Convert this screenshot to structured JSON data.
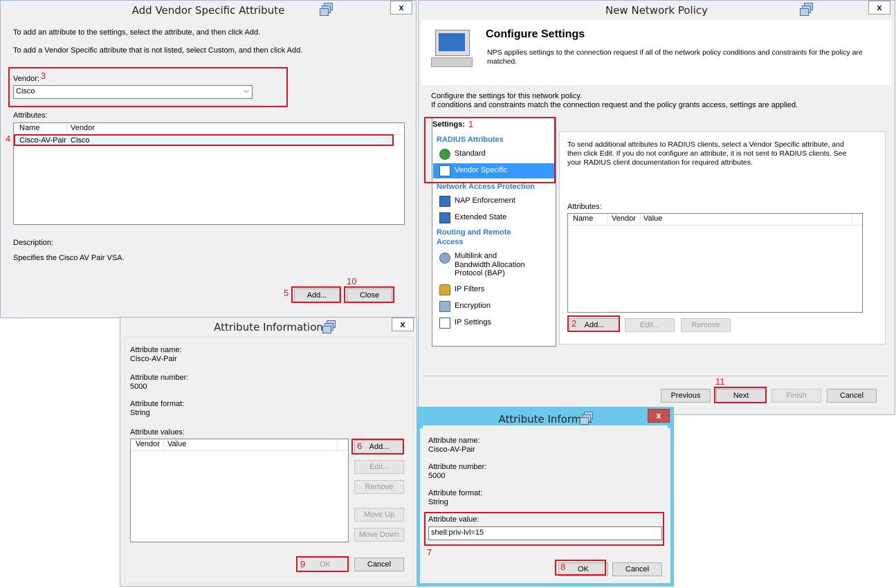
{
  "vsa_dialog": {
    "title": "Add Vendor Specific Attribute",
    "close_glyph": "x",
    "instruction1": "To add an attribute to the settings, select the attribute, and then click Add.",
    "instruction2": "To add a Vendor Specific attribute that is not listed, select Custom, and then click Add.",
    "vendor_label": "Vendor:",
    "vendor_value": "Cisco",
    "attributes_label": "Attributes:",
    "columns": [
      "Name",
      "Vendor"
    ],
    "rows": [
      {
        "name": "Cisco-AV-Pair",
        "vendor": "Cisco"
      }
    ],
    "description_label": "Description:",
    "description_text": "Specifies the Cisco AV Pair VSA.",
    "add_label": "Add...",
    "close_label": "Close"
  },
  "policy_window": {
    "title": "New Network Policy",
    "close_glyph": "x",
    "header_title": "Configure Settings",
    "header_text": "NPS applies settings to the connection request if all of the network policy conditions and constraints for the policy are matched.",
    "intro1": "Configure the settings for this network policy.",
    "intro2": "If conditions and constraints match the connection request and the policy grants access, settings are applied.",
    "settings_label": "Settings:",
    "nav": {
      "radius_header": "RADIUS Attributes",
      "standard": "Standard",
      "vendor_specific": "Vendor Specific",
      "nap_header": "Network Access Protection",
      "nap_enforcement": "NAP Enforcement",
      "extended_state": "Extended State",
      "routing_header_1": "Routing and Remote",
      "routing_header_2": "Access",
      "multilink_1": "Multilink and",
      "multilink_2": "Bandwidth Allocation",
      "multilink_3": "Protocol (BAP)",
      "ip_filters": "IP Filters",
      "encryption": "Encryption",
      "ip_settings": "IP Settings"
    },
    "panel_text": "To send additional attributes to RADIUS clients, select a Vendor Specific attribute, and then click Edit. If you do not configure an attribute, it is not sent to RADIUS clients. See your RADIUS client documentation for required attributes.",
    "attributes_label": "Attributes:",
    "columns": [
      "Name",
      "Vendor",
      "Value"
    ],
    "add_label": "Add...",
    "edit_label": "Edit...",
    "remove_label": "Remove",
    "previous_label": "Previous",
    "next_label": "Next",
    "finish_label": "Finish",
    "cancel_label": "Cancel"
  },
  "attr_info_1": {
    "title": "Attribute Information",
    "close_glyph": "x",
    "name_label": "Attribute name:",
    "name_value": "Cisco-AV-Pair",
    "number_label": "Attribute number:",
    "number_value": "5000",
    "format_label": "Attribute format:",
    "format_value": "String",
    "values_label": "Attribute values:",
    "columns": [
      "Vendor",
      "Value"
    ],
    "add_label": "Add...",
    "edit_label": "Edit...",
    "remove_label": "Remove",
    "move_up_label": "Move Up",
    "move_down_label": "Move Down",
    "ok_label": "OK",
    "cancel_label": "Cancel"
  },
  "attr_info_2": {
    "title": "Attribute Informat",
    "close_glyph": "x",
    "name_label": "Attribute name:",
    "name_value": "Cisco-AV-Pair",
    "number_label": "Attribute number:",
    "number_value": "5000",
    "format_label": "Attribute format:",
    "format_value": "String",
    "value_label": "Attribute value:",
    "value_input": "shell:priv-lvl=15",
    "ok_label": "OK",
    "cancel_label": "Cancel"
  },
  "step_numbers": {
    "s1": "1",
    "s2": "2",
    "s3": "3",
    "s4": "4",
    "s5": "5",
    "s6": "6",
    "s7": "7",
    "s8": "8",
    "s9": "9",
    "s10": "10",
    "s11": "11"
  },
  "colors": {
    "highlight_red": "#e0141e",
    "selection_blue": "#3399ff",
    "link_blue": "#2a7fd4",
    "active_frame": "#6cc8ea"
  }
}
